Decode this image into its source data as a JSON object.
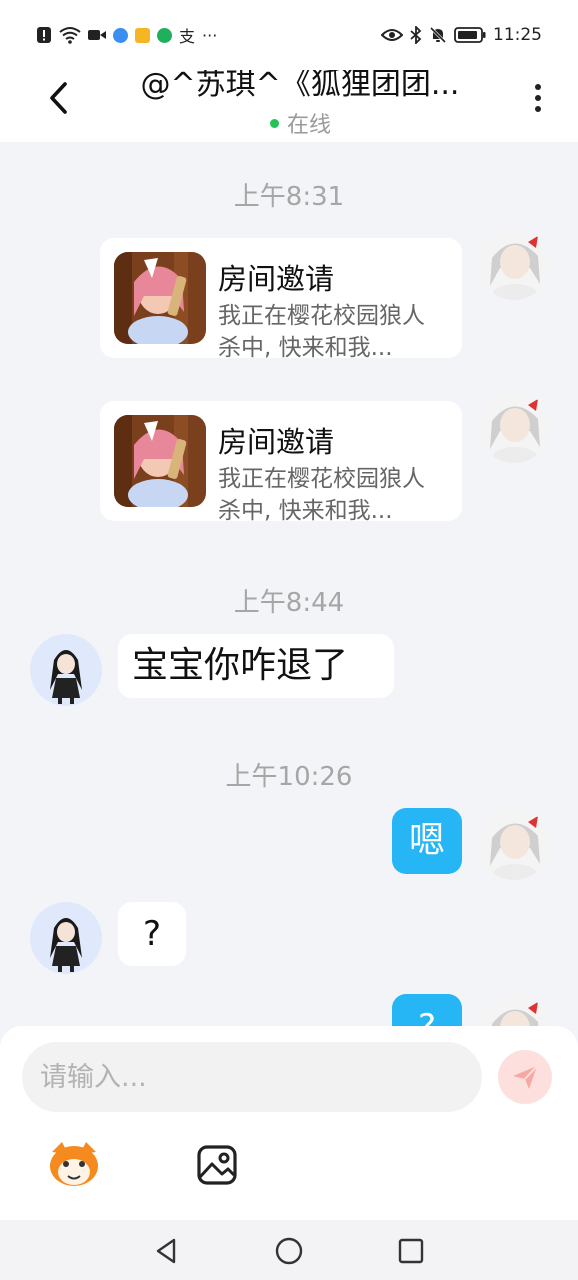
{
  "status_bar": {
    "time": "11:25",
    "left_icons": [
      "alert-icon",
      "wifi-icon",
      "video-icon",
      "app-blue-icon",
      "app-yellow-icon",
      "app-green-icon",
      "alipay-icon"
    ],
    "alipay_glyph": "支",
    "more_dots": "···",
    "right_icons": [
      "eye-icon",
      "bluetooth-icon",
      "mute-bell-icon",
      "battery-icon"
    ]
  },
  "header": {
    "title": "@^苏琪^《狐狸团团...",
    "status": "在线",
    "status_color": "#22c45a"
  },
  "messages": [
    {
      "type": "time",
      "text": "上午8:31"
    },
    {
      "type": "card",
      "side": "right",
      "title": "房间邀请",
      "desc": "我正在樱花校园狼人杀中, 快来和我..."
    },
    {
      "type": "card",
      "side": "right",
      "title": "房间邀请",
      "desc": "我正在樱花校园狼人杀中, 快来和我..."
    },
    {
      "type": "time",
      "text": "上午8:44"
    },
    {
      "type": "text",
      "side": "left",
      "text": "宝宝你咋退了"
    },
    {
      "type": "time",
      "text": "上午10:26"
    },
    {
      "type": "text",
      "side": "right",
      "text": "嗯"
    },
    {
      "type": "text",
      "side": "left",
      "text": "?"
    },
    {
      "type": "text",
      "side": "right",
      "text": "?"
    }
  ],
  "input": {
    "placeholder": "请输入..."
  },
  "colors": {
    "outgoing_bubble": "#26b6f6",
    "send_button": "#fde0de",
    "send_arrow": "#f7a8a2"
  },
  "toolbar": {
    "items": [
      "emoji-icon",
      "image-icon"
    ]
  },
  "nav_bar": {
    "items": [
      "back-triangle-icon",
      "home-circle-icon",
      "recents-square-icon"
    ]
  }
}
